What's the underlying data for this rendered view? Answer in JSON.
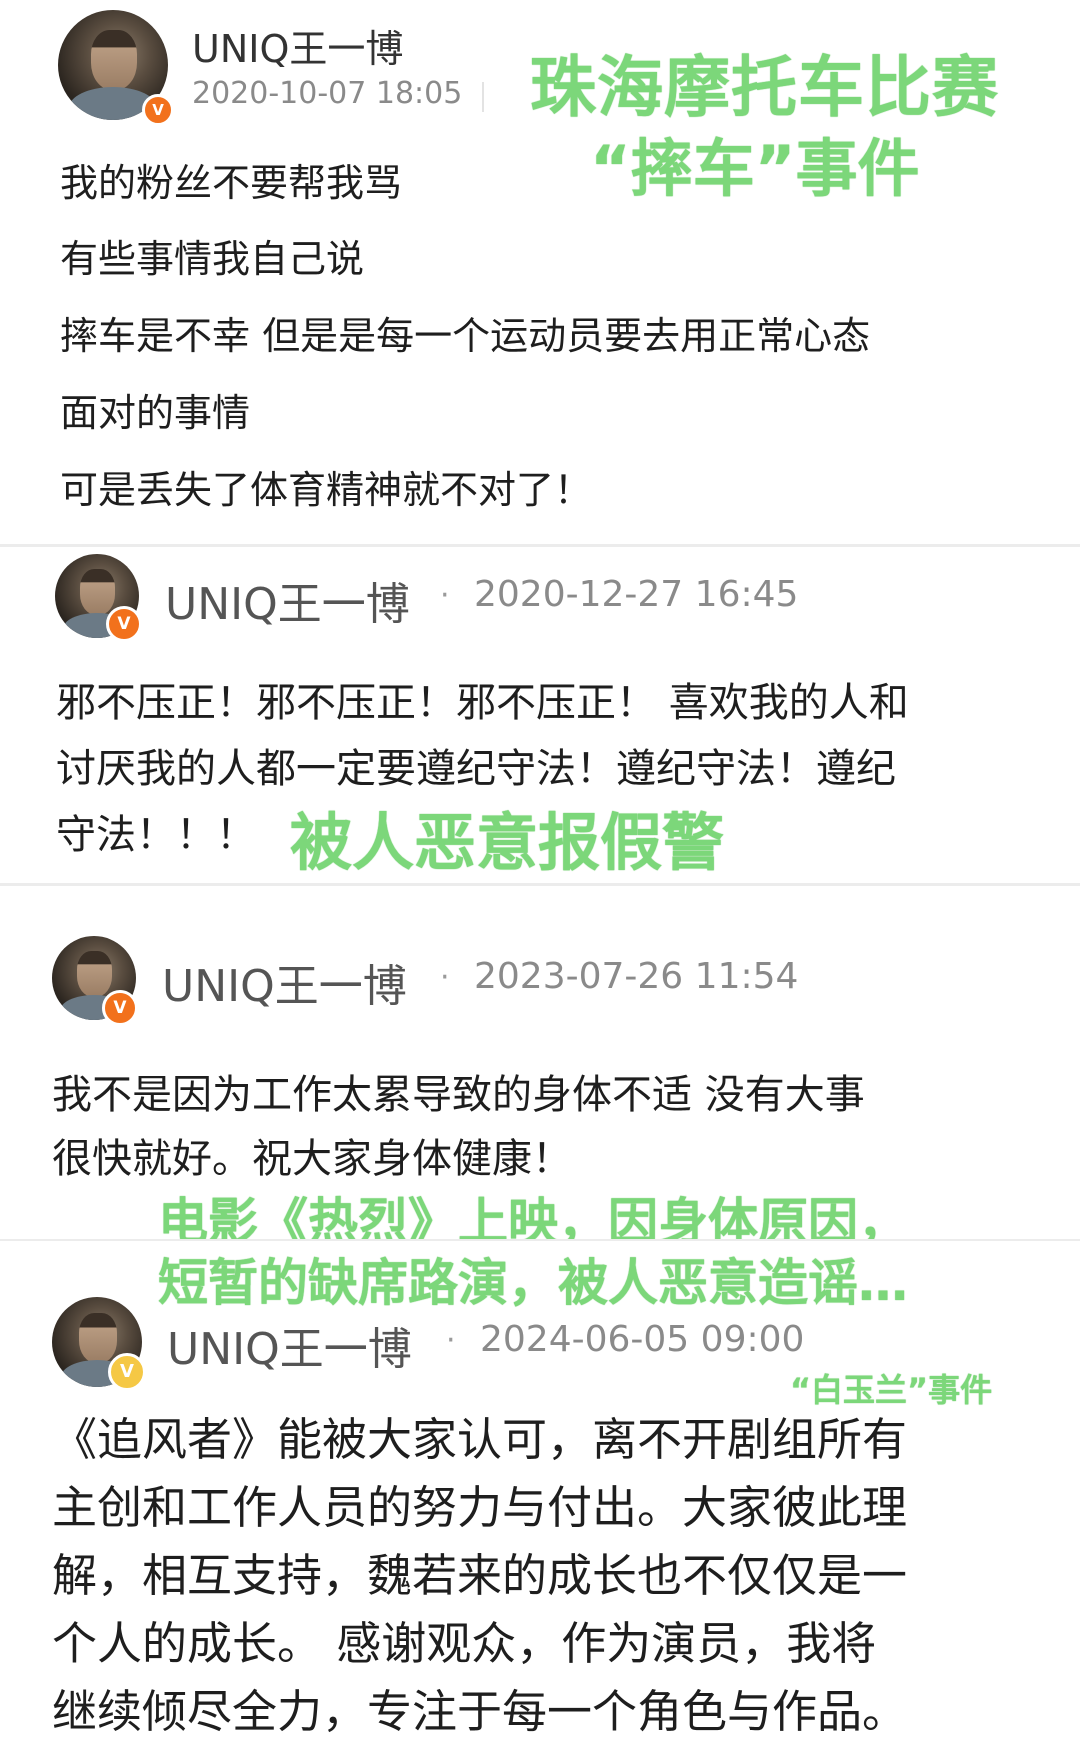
{
  "posts": [
    {
      "username": "UNIQ王一博",
      "timestamp": "2020-10-07 18:05",
      "lines": [
        "我的粉丝不要帮我骂",
        "有些事情我自己说",
        "摔车是不幸 但是是每一个运动员要去用正常心态",
        "面对的事情",
        "可是丢失了体育精神就不对了！"
      ],
      "annotation": [
        "珠海摩托车比赛",
        "“摔车”事件"
      ],
      "badge": "V"
    },
    {
      "username": "UNIQ王一博",
      "separator": "·",
      "timestamp": "2020-12-27 16:45",
      "lines": [
        "邪不压正！邪不压正！邪不压正！ 喜欢我的人和",
        "讨厌我的人都一定要遵纪守法！遵纪守法！遵纪",
        "守法！！！"
      ],
      "annotation": [
        "被人恶意报假警"
      ],
      "badge": "V"
    },
    {
      "username": "UNIQ王一博",
      "separator": "·",
      "timestamp": "2023-07-26 11:54",
      "lines": [
        "我不是因为工作太累导致的身体不适 没有大事",
        "很快就好。祝大家身体健康！"
      ],
      "annotation": [
        "电影《热烈》上映，因身体原因，",
        "短暂的缺席路演，被人恶意造谣…"
      ],
      "badge": "V"
    },
    {
      "username": "UNIQ王一博",
      "separator": "·",
      "timestamp": "2024-06-05 09:00",
      "lines": [
        "《追风者》能被大家认可，离不开剧组所有",
        "主创和工作人员的努力与付出。大家彼此理",
        "解，相互支持，魏若来的成长也不仅仅是一",
        "个人的成长。 感谢观众，作为演员，我将",
        "继续倾尽全力，专注于每一个角色与作品。"
      ],
      "annotation": [
        "“白玉兰”事件"
      ],
      "badge": "V"
    }
  ],
  "colors": {
    "annotation": "#7cd77a",
    "badge_orange": "#f2711c",
    "badge_gold": "#f5c845",
    "timestamp": "#8a8a8a"
  },
  "icons": {
    "avatar": "avatar-photo",
    "verified": "verified-badge-icon"
  }
}
